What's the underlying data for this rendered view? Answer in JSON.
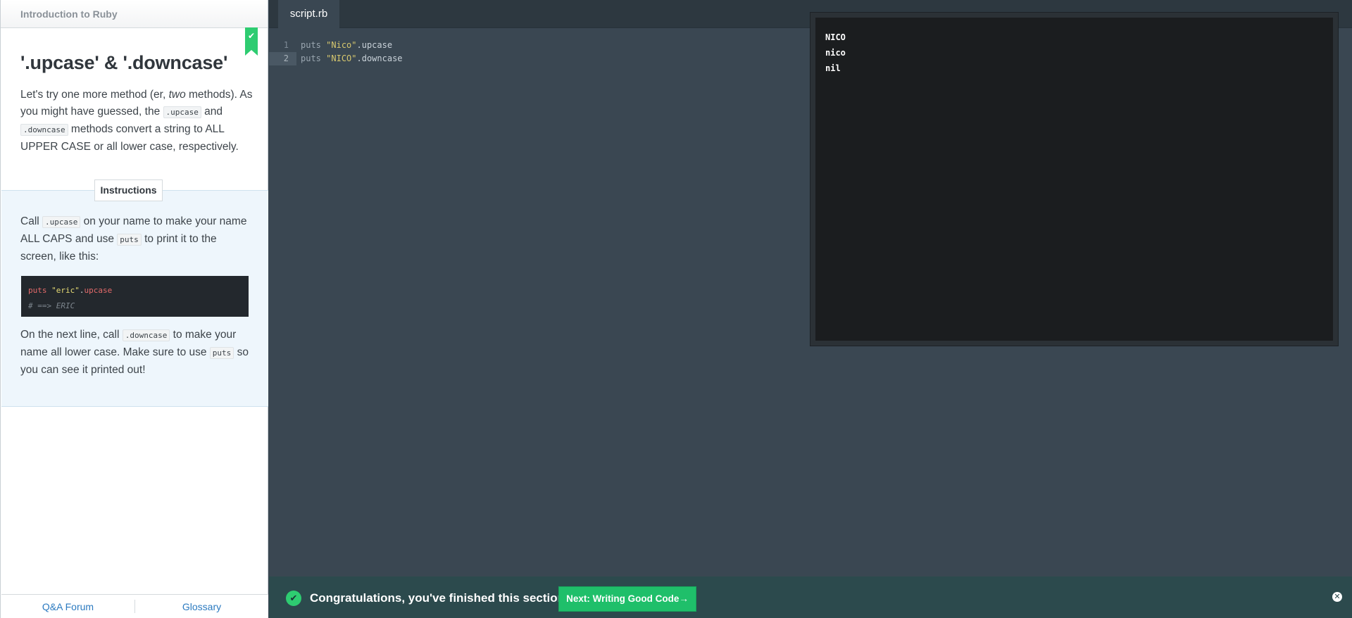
{
  "sidebar": {
    "course_title": "Introduction to Ruby",
    "lesson_title": "'.upcase' & '.downcase'",
    "intro": {
      "p1": "Let's try one more method (er, ",
      "p1_em": "two",
      "p1_b": " methods). As you might have guessed, the ",
      "code_upcase": ".upcase",
      "p1_c": " and ",
      "code_downcase": ".downcase",
      "p1_d": " methods convert a string to ALL UPPER CASE or all lower case, respectively."
    },
    "instructions_tab": "Instructions",
    "instructions": {
      "a1": "Call ",
      "code_upcase": ".upcase",
      "a2": " on your name to make your name ALL CAPS and use ",
      "code_puts": "puts",
      "a3": " to print it to the screen, like this:",
      "example_kw": "puts",
      "example_str": "\"eric\"",
      "example_dot": ".",
      "example_meth": "upcase",
      "example_comment": "# ==> ERIC",
      "b1": "On the next line, call ",
      "code_downcase": ".downcase",
      "b2": " to make your name all lower case. Make sure to use ",
      "code_puts2": "puts",
      "b3": " so you can see it printed out!"
    },
    "footer": {
      "forum": "Q&A Forum",
      "glossary": "Glossary"
    }
  },
  "editor": {
    "tab": "script.rb",
    "lines": [
      {
        "num": "1",
        "kw": "puts",
        "str": "\"Nico\"",
        "meth": ".upcase"
      },
      {
        "num": "2",
        "kw": "puts",
        "str": "\"NICO\"",
        "meth": ".downcase"
      }
    ]
  },
  "output": {
    "lines": [
      "NICO",
      "nico",
      "nil"
    ]
  },
  "banner": {
    "message": "Congratulations, you've finished this section!",
    "next_button": "Next: Writing Good Code→",
    "check_glyph": "✔",
    "close_glyph": "✕"
  },
  "colors": {
    "accent_green": "#2ecc71",
    "editor_bg": "#3a4752",
    "banner_bg": "#2c4a4d"
  }
}
